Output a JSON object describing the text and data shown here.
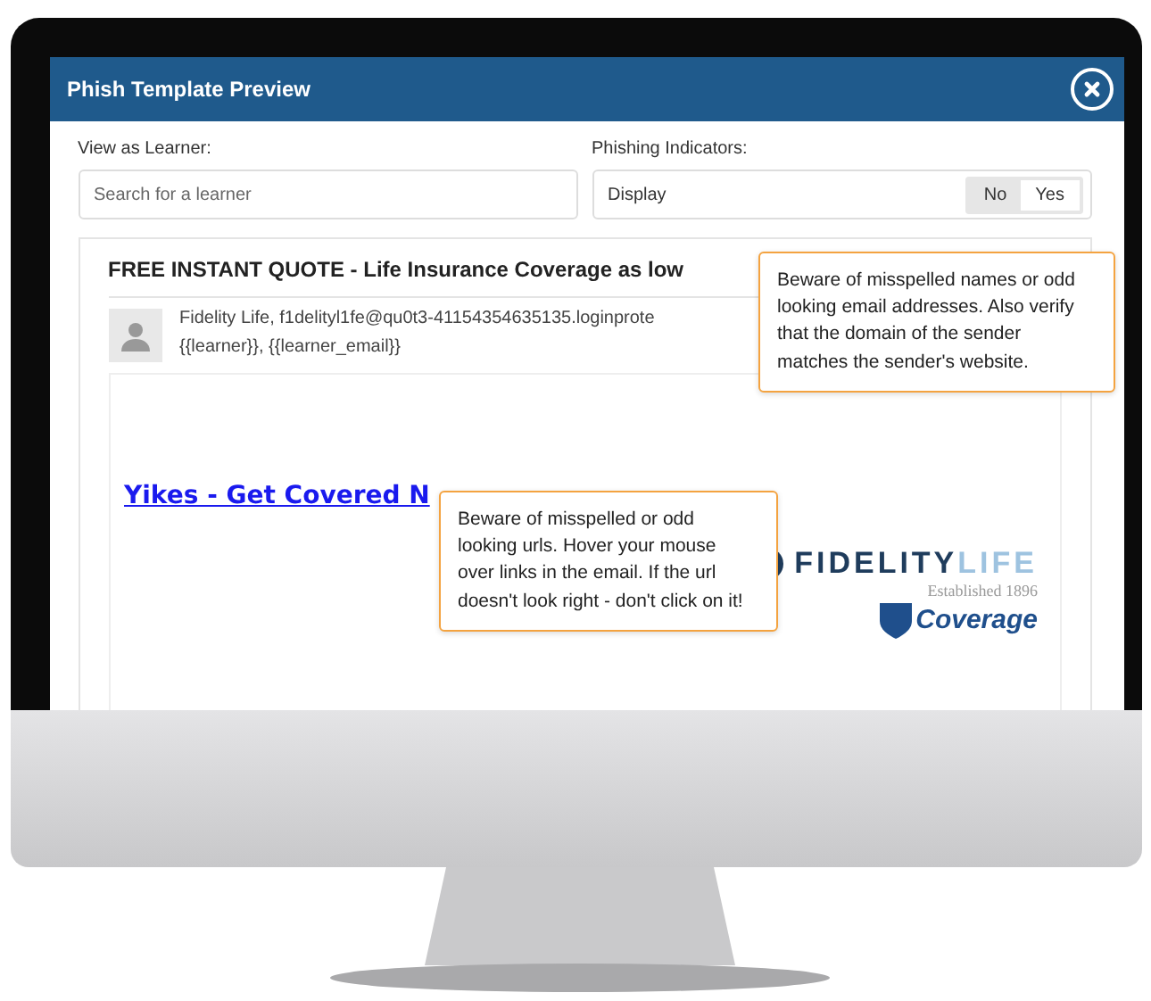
{
  "modal": {
    "title": "Phish Template Preview",
    "learner": {
      "label": "View as Learner:",
      "placeholder": "Search for a learner"
    },
    "indicators": {
      "label": "Phishing Indicators:",
      "display": "Display",
      "options": [
        {
          "label": "No",
          "selected": false
        },
        {
          "label": "Yes",
          "selected": true
        }
      ]
    },
    "email": {
      "subject": "FREE INSTANT QUOTE - Life Insurance Coverage as low",
      "sender": "Fidelity Life, f1delityl1fe@qu0t3-41154354635135.loginprote",
      "recipient": "{{learner}}, {{learner_email}}",
      "link": "Yikes - Get Covered N",
      "logo": {
        "brand": "FIDELITY",
        "brand_suffix": "LIFE",
        "tagline": "Established 1896",
        "partner": "Coverage"
      }
    },
    "tooltips": [
      {
        "text": "Beware of misspelled names or odd looking email addresses. Also verify that the domain of the sender matches the sender's website."
      },
      {
        "text": "Beware of misspelled or odd looking urls. Hover your mouse over links in the email. If the url doesn't look right - don't click on it!"
      }
    ]
  }
}
